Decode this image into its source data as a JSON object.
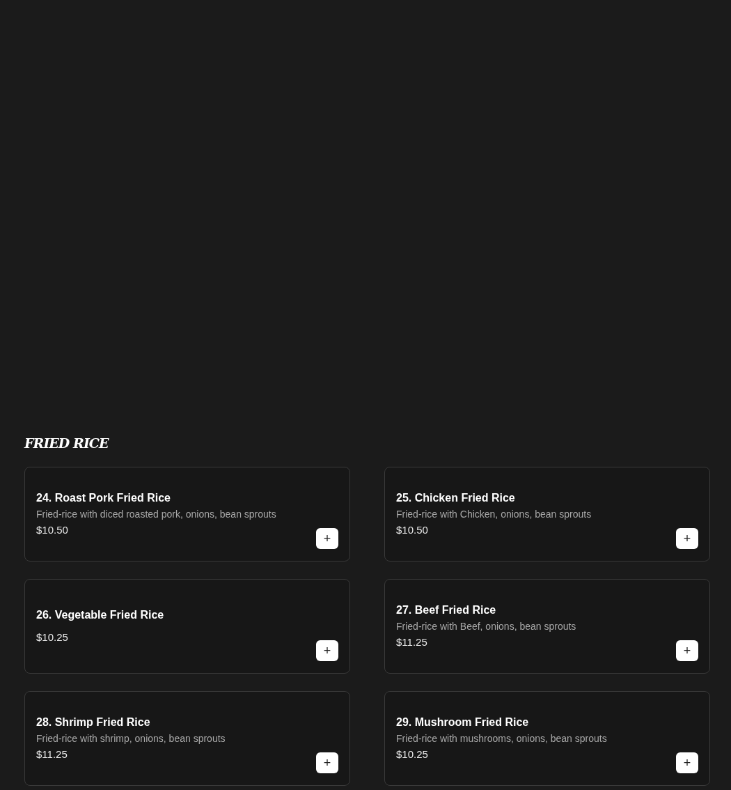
{
  "section": {
    "title": "FRIED RICE"
  },
  "items": [
    {
      "name": "24. Roast Pork Fried Rice",
      "description": "Fried-rice with diced roasted pork, onions, bean sprouts",
      "price": "$10.50",
      "add": "+"
    },
    {
      "name": "25. Chicken Fried Rice",
      "description": "Fried-rice with Chicken, onions, bean sprouts",
      "price": "$10.50",
      "add": "+"
    },
    {
      "name": "26. Vegetable Fried Rice",
      "price": "$10.25",
      "add": "+"
    },
    {
      "name": "27. Beef Fried Rice",
      "description": "Fried-rice with Beef, onions, bean sprouts",
      "price": "$11.25",
      "add": "+"
    },
    {
      "name": "28. Shrimp Fried Rice",
      "description": "Fried-rice with shrimp, onions, bean sprouts",
      "price": "$11.25",
      "add": "+"
    },
    {
      "name": "29. Mushroom Fried Rice",
      "description": "Fried-rice with mushrooms, onions, bean sprouts",
      "price": "$10.25",
      "add": "+"
    }
  ]
}
